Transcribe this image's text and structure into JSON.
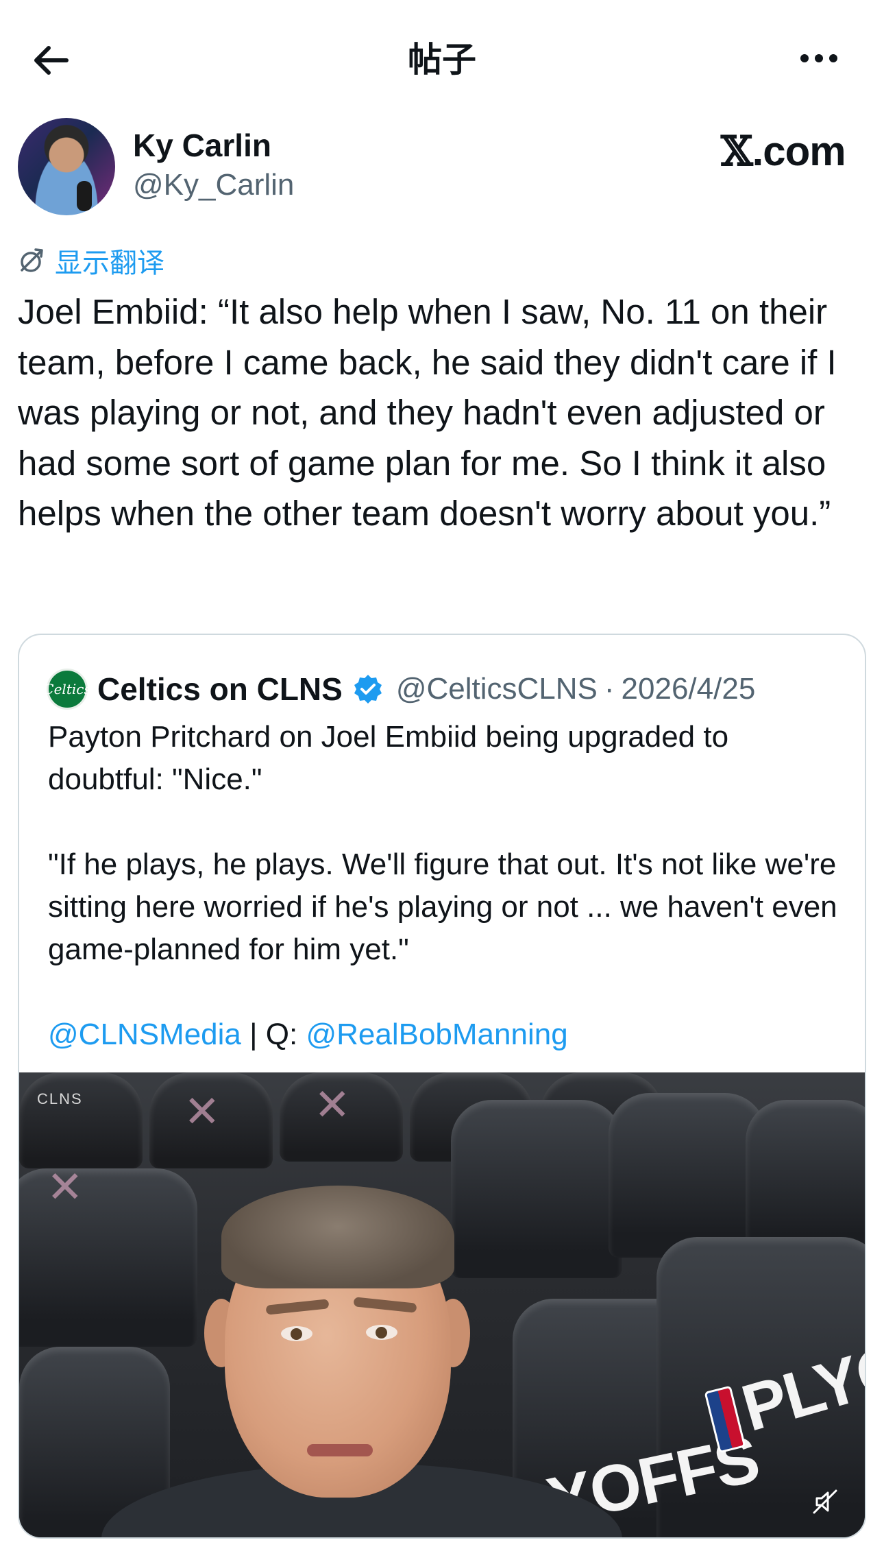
{
  "nav": {
    "title": "帖子",
    "back_icon": "arrow-left-icon",
    "more_icon": "more-horizontal-icon"
  },
  "author": {
    "name": "Ky Carlin",
    "handle": "@Ky_Carlin",
    "source_brand": "X.com"
  },
  "translate": {
    "label": "显示翻译",
    "icon": "translate-icon"
  },
  "post": {
    "text": "Joel Embiid: “It also help when I saw, No. 11 on their team, before I came back, he said they didn't care if I was playing or not, and they hadn't even adjusted or had some sort of game plan for me. So I think it also helps when the other team doesn't worry about you.”"
  },
  "quote": {
    "logo_text": "Celtics",
    "name": "Celtics on CLNS",
    "verified_icon": "verified-badge-icon",
    "handle": "@CelticsCLNS",
    "separator": "·",
    "date": "2026/4/25",
    "paragraph1": "Payton Pritchard on Joel Embiid being upgraded to doubtful: \"Nice.\"",
    "paragraph2": "\"If he plays, he plays. We'll figure that out. It's not like we're sitting here worried if he's playing or not ... we haven't even game-planned for him yet.\"",
    "mention1": "@CLNSMedia",
    "between": " | Q: ",
    "mention2": "@RealBobManning",
    "media": {
      "watermark": "CLNS",
      "seat_text_left": "YOFFS",
      "seat_text_right": "PLYOFFS",
      "mute_icon": "volume-muted-icon"
    }
  },
  "colors": {
    "link": "#1d9bf0",
    "secondary_text": "#536471",
    "border": "#cfd9de"
  }
}
